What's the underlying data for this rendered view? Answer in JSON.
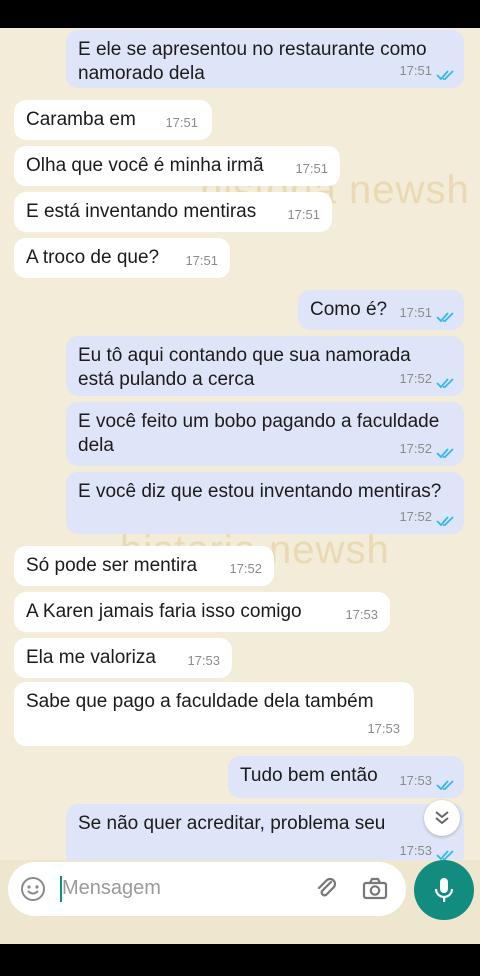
{
  "watermark": [
    "historia newsh",
    "historia newsh"
  ],
  "messages": [
    {
      "side": "out",
      "text": "E ele se apresentou no restaurante como\nnamorado dela",
      "time": "17:51",
      "read": true
    },
    {
      "side": "in",
      "text": "Caramba em",
      "time": "17:51"
    },
    {
      "side": "in",
      "text": "Olha que você é minha irmã",
      "time": "17:51"
    },
    {
      "side": "in",
      "text": "E está inventando mentiras",
      "time": "17:51"
    },
    {
      "side": "in",
      "text": "A troco de que?",
      "time": "17:51"
    },
    {
      "side": "out",
      "text": "Como é?",
      "time": "17:51",
      "read": true
    },
    {
      "side": "out",
      "text": "Eu tô aqui contando que sua namorada\nestá pulando a cerca",
      "time": "17:52",
      "read": true
    },
    {
      "side": "out",
      "text": "E você feito um bobo pagando a faculdade\ndela",
      "time": "17:52",
      "read": true
    },
    {
      "side": "out",
      "text": "E você diz que estou inventando mentiras?",
      "time": "17:52",
      "read": true
    },
    {
      "side": "in",
      "text": "Só pode ser mentira",
      "time": "17:52"
    },
    {
      "side": "in",
      "text": "A Karen jamais faria isso comigo",
      "time": "17:53"
    },
    {
      "side": "in",
      "text": "Ela me valoriza",
      "time": "17:53"
    },
    {
      "side": "in",
      "text": "Sabe que pago a faculdade dela também",
      "time": "17:53"
    },
    {
      "side": "out",
      "text": "Tudo bem então",
      "time": "17:53",
      "read": true
    },
    {
      "side": "out",
      "text": "Se não quer acreditar, problema seu",
      "time": "17:53",
      "read": true
    }
  ],
  "composer": {
    "placeholder": "Mensagem",
    "emoji_icon": "emoji-icon",
    "attach_icon": "paperclip-icon",
    "camera_icon": "camera-icon",
    "mic_icon": "microphone-icon"
  },
  "colors": {
    "chat_bg": "#f3ecd8",
    "incoming": "#ffffff",
    "outgoing": "#dfe5f8",
    "read_tick": "#34b7f1",
    "accent": "#128c7e"
  }
}
